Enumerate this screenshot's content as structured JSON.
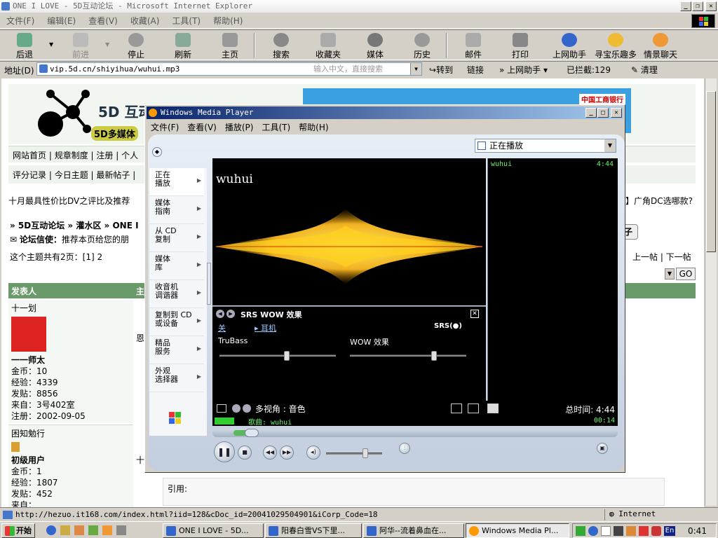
{
  "ie": {
    "title": "ONE I LOVE - 5D互动论坛 - Microsoft Internet Explorer",
    "menu": [
      "文件(F)",
      "编辑(E)",
      "查看(V)",
      "收藏(A)",
      "工具(T)",
      "帮助(H)"
    ],
    "toolbar": [
      "后退",
      "前进",
      "停止",
      "刷新",
      "主页",
      "搜索",
      "收藏夹",
      "媒体",
      "历史",
      "邮件",
      "打印",
      "上网助手",
      "寻宝乐趣多",
      "情景聊天"
    ],
    "address_label": "地址(D)",
    "address": "vip.5d.cn/shiyihua/wuhui.mp3",
    "address_hint": "输入中文，直接搜索",
    "go_label": "转到",
    "links_label": "链接",
    "assistant_label": "上网助手",
    "blocked_label": "已拦截:129",
    "clean_label": "清理",
    "status_url": "http://hezuo.it168.com/index.html?iid=128&cDoc_id=20041029504901&iCorp_Code=18",
    "status_zone": "Internet"
  },
  "page": {
    "logo_text": "5D 互动论坛",
    "logo_sub": "5D多媒体",
    "nav1": [
      "网站首页",
      "规章制度",
      "注册",
      "个人"
    ],
    "nav2": [
      "评分记录",
      "今日主题",
      "最新帖子"
    ],
    "headline": "十月最具性价比DV之评比及推荐",
    "headline_right": "【】广角DC选哪款?",
    "breadcrumb": "» 5D互动论坛  » 灌水区  » ONE I",
    "messenger_label": "论坛信使：",
    "messenger_text": "推荐本页给您的朋",
    "pages_text": "这个主题共有2页：[1] 2",
    "prev_next": "上一帖  |  下一帖",
    "reply_btn": "子",
    "go_btn": "GO",
    "col_author": "发表人",
    "col_topic": "主",
    "post1": {
      "name": "十一划",
      "rank": "一一师太",
      "stats": [
        "金币：10",
        "经验：4339",
        "发贴：8856",
        "来自：3号402室",
        "注册：2002-09-05"
      ],
      "snippet": "恩"
    },
    "post2": {
      "name": "困知勉行",
      "rank": "初级用户",
      "stats": [
        "金币：1",
        "经验：1807",
        "发贴：452",
        "来自："
      ],
      "snippet": "十"
    },
    "quote_label": "引用:",
    "ad_text": "中国工商银行"
  },
  "wmp": {
    "title": "Windows Media Player",
    "menu": [
      "文件(F)",
      "查看(V)",
      "播放(P)",
      "工具(T)",
      "帮助(H)"
    ],
    "now_playing_select": "正在播放",
    "tasks": [
      "正在\n播放",
      "媒体\n指南",
      "从 CD\n复制",
      "媒体\n库",
      "收音机\n调谐器",
      "复制到 CD\n或设备",
      "精品\n服务",
      "外观\n选择器"
    ],
    "track": "wuhui",
    "playlist": [
      {
        "title": "wuhui",
        "time": "4:44"
      }
    ],
    "srs_title": "SRS WOW 效果",
    "srs_off": "关",
    "srs_mode": "耳机",
    "srs_logo": "SRS(●)",
    "trubass_label": "TruBass",
    "wow_label": "WOW 效果",
    "trubass_level": 0.58,
    "wow_level": 0.72,
    "view_label": "多视角 : 音色",
    "total_time": "总时间: 4:44",
    "song_label": "歌曲: wuhui",
    "elapsed": "00:14",
    "progress": 0.05,
    "volume": 0.7
  },
  "taskbar": {
    "start": "开始",
    "tasks": [
      "ONE I LOVE - 5D...",
      "阳春白雪VS下里...",
      "阿华--流着鼻血在...",
      "Windows Media Pl..."
    ],
    "clock": "0:41",
    "ime": "En"
  }
}
